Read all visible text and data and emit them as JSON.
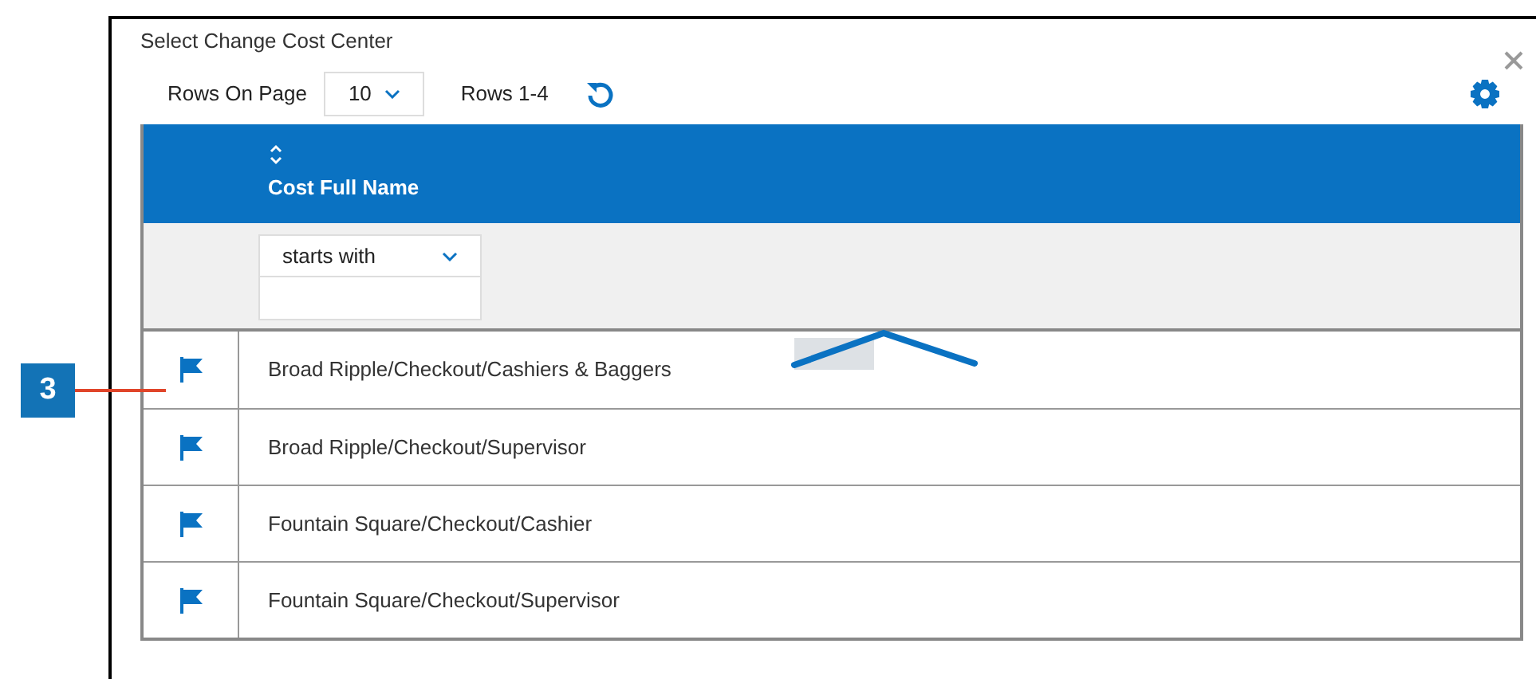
{
  "dialog": {
    "title": "Select Change Cost Center"
  },
  "toolbar": {
    "rows_on_page_label": "Rows On Page",
    "rows_on_page_value": "10",
    "rows_range": "Rows 1-4"
  },
  "table": {
    "columns": [
      {
        "label": "Cost Full Name"
      }
    ],
    "filter": {
      "operator": "starts with"
    },
    "rows": [
      {
        "name": "Broad Ripple/Checkout/Cashiers & Baggers"
      },
      {
        "name": "Broad Ripple/Checkout/Supervisor"
      },
      {
        "name": "Fountain Square/Checkout/Cashier"
      },
      {
        "name": "Fountain Square/Checkout/Supervisor"
      }
    ]
  },
  "callout": {
    "label": "3"
  }
}
